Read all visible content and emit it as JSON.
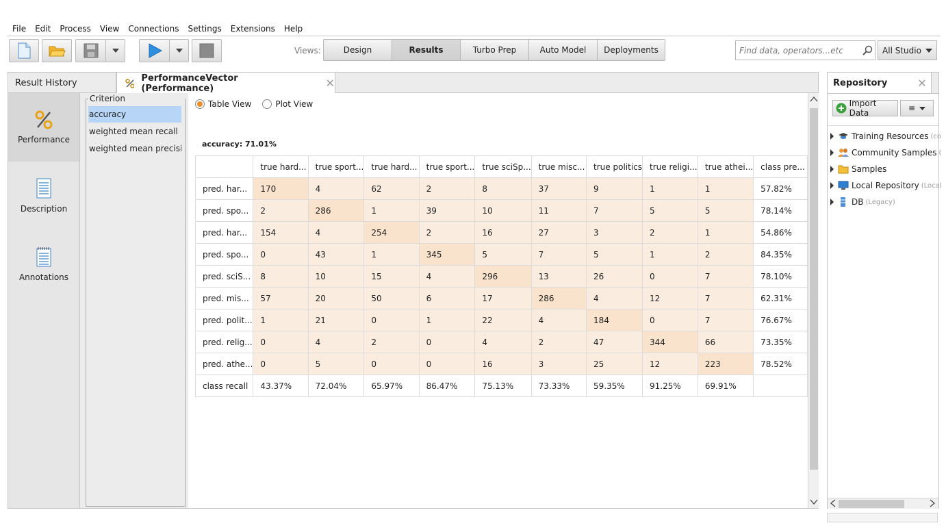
{
  "menu": [
    "File",
    "Edit",
    "Process",
    "View",
    "Connections",
    "Settings",
    "Extensions",
    "Help"
  ],
  "views": {
    "label": "Views:",
    "tabs": [
      "Design",
      "Results",
      "Turbo Prep",
      "Auto Model",
      "Deployments"
    ],
    "active": "Results"
  },
  "search": {
    "placeholder": "Find data, operators...etc"
  },
  "studio": {
    "label": "All Studio"
  },
  "tabs": {
    "result_history": "Result History",
    "performance_vector": "PerformanceVector (Performance)"
  },
  "side": {
    "performance": "Performance",
    "description": "Description",
    "annotations": "Annotations"
  },
  "criterion": {
    "legend": "Criterion",
    "items": [
      "accuracy",
      "weighted mean recall",
      "weighted mean precisi..."
    ],
    "selected": "accuracy"
  },
  "view_mode": {
    "table": "Table View",
    "plot": "Plot View",
    "selected": "Table View"
  },
  "accuracy_title": "accuracy: 71.01%",
  "matrix": {
    "headers": [
      "",
      "true hard...",
      "true sport...",
      "true hard...",
      "true sport...",
      "true sciSp...",
      "true misc...",
      "true politics",
      "true religi...",
      "true athei...",
      "class pre..."
    ],
    "rows": [
      [
        "pred. har...",
        "170",
        "4",
        "62",
        "2",
        "8",
        "37",
        "9",
        "1",
        "1",
        "57.82%"
      ],
      [
        "pred. spo...",
        "2",
        "286",
        "1",
        "39",
        "10",
        "11",
        "7",
        "5",
        "5",
        "78.14%"
      ],
      [
        "pred. har...",
        "154",
        "4",
        "254",
        "2",
        "16",
        "27",
        "3",
        "2",
        "1",
        "54.86%"
      ],
      [
        "pred. spo...",
        "0",
        "43",
        "1",
        "345",
        "5",
        "7",
        "5",
        "1",
        "2",
        "84.35%"
      ],
      [
        "pred. sciS...",
        "8",
        "10",
        "15",
        "4",
        "296",
        "13",
        "26",
        "0",
        "7",
        "78.10%"
      ],
      [
        "pred. mis...",
        "57",
        "20",
        "50",
        "6",
        "17",
        "286",
        "4",
        "12",
        "7",
        "62.31%"
      ],
      [
        "pred. polit...",
        "1",
        "21",
        "0",
        "1",
        "22",
        "4",
        "184",
        "0",
        "7",
        "76.67%"
      ],
      [
        "pred. relig...",
        "0",
        "4",
        "2",
        "0",
        "4",
        "2",
        "47",
        "344",
        "66",
        "73.35%"
      ],
      [
        "pred. athe...",
        "0",
        "5",
        "0",
        "0",
        "16",
        "3",
        "25",
        "12",
        "223",
        "78.52%"
      ]
    ],
    "recall": [
      "class recall",
      "43.37%",
      "72.04%",
      "65.97%",
      "86.47%",
      "75.13%",
      "73.33%",
      "59.35%",
      "91.25%",
      "69.91%",
      ""
    ]
  },
  "repository": {
    "title": "Repository",
    "import_label": "Import Data",
    "items": [
      {
        "label": "Training Resources",
        "suffix": "(co",
        "icon": "graduation-cap-icon"
      },
      {
        "label": "Community Samples",
        "suffix": "(",
        "icon": "people-icon"
      },
      {
        "label": "Samples",
        "suffix": "",
        "icon": "folder-icon"
      },
      {
        "label": "Local Repository",
        "suffix": "(Local",
        "icon": "monitor-icon"
      },
      {
        "label": "DB",
        "suffix": "(Legacy)",
        "icon": "database-icon"
      }
    ]
  },
  "colors": {
    "accent": "#f08b2a",
    "selection": "#b7d5f6",
    "diag": "#f9e3cc",
    "cell": "#faede0"
  }
}
